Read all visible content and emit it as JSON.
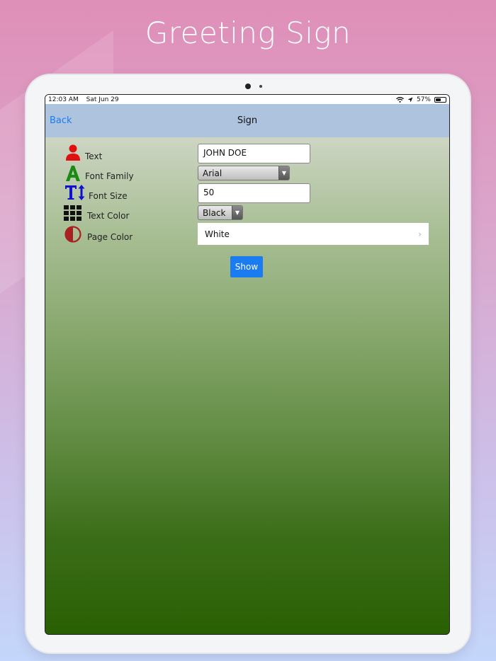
{
  "promo": {
    "title": "Greeting Sign"
  },
  "status": {
    "time": "12:03 AM",
    "date": "Sat Jun 29",
    "battery": "57%",
    "battery_level": 0.57
  },
  "nav": {
    "back": "Back",
    "title": "Sign"
  },
  "form": {
    "text": {
      "label": "Text",
      "value": "JOHN DOE",
      "icon": "person-icon"
    },
    "font_family": {
      "label": "Font Family",
      "value": "Arial",
      "icon": "letter-a-icon"
    },
    "font_size": {
      "label": "Font Size",
      "value": "50",
      "icon": "text-size-icon"
    },
    "text_color": {
      "label": "Text Color",
      "value": "Black",
      "icon": "grid-icon"
    },
    "page_color": {
      "label": "Page Color",
      "value": "White",
      "icon": "half-circle-icon"
    }
  },
  "show_button": "Show",
  "colors": {
    "accent": "#1a7cf0",
    "navbar": "#aec4de",
    "text_icon": "#e01010",
    "font_icon": "#1a8a14",
    "size_icon": "#1010d0",
    "page_icon": "#a82020"
  }
}
